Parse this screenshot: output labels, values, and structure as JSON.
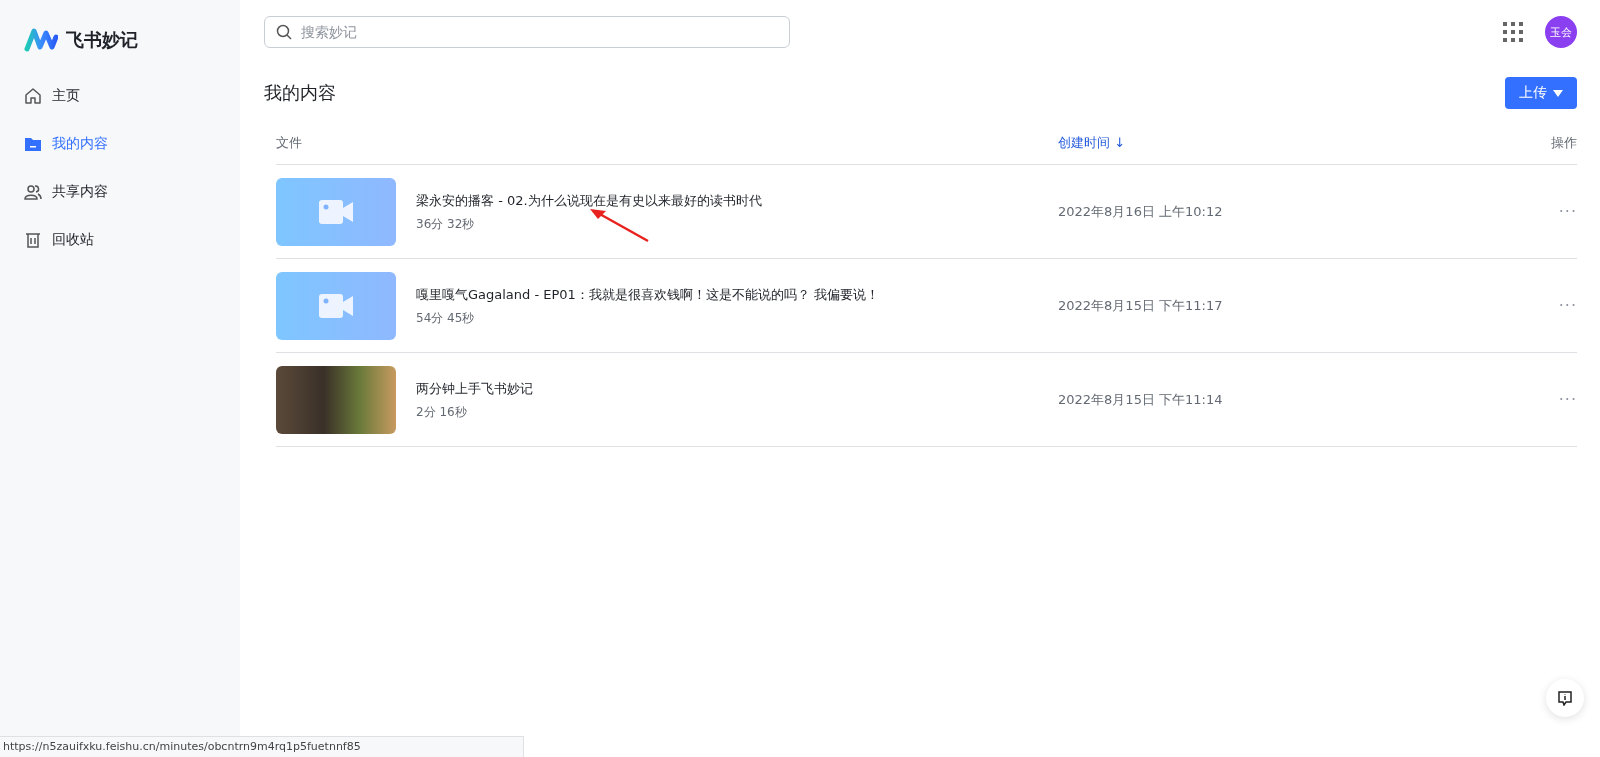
{
  "app": {
    "name": "飞书妙记"
  },
  "sidebar": {
    "items": [
      {
        "label": "主页",
        "kind": "home",
        "selected": false
      },
      {
        "label": "我的内容",
        "kind": "folder",
        "selected": true
      },
      {
        "label": "共享内容",
        "kind": "people",
        "selected": false
      },
      {
        "label": "回收站",
        "kind": "trash",
        "selected": false
      }
    ]
  },
  "search": {
    "placeholder": "搜索妙记"
  },
  "avatar": {
    "text": "玉会"
  },
  "page_title": "我的内容",
  "upload_button": {
    "label": "上传"
  },
  "table": {
    "columns": [
      {
        "label": "文件",
        "sorted": false
      },
      {
        "label": "创建时间 ↓",
        "sorted": true
      },
      {
        "label": "操作",
        "sorted": false
      }
    ],
    "rows": [
      {
        "kind": "video",
        "title": "梁永安的播客 - 02.为什么说现在是有史以来最好的读书时代",
        "duration": "36分 32秒",
        "created": "2022年8月16日 上午10:12",
        "more": "···",
        "annotated": true
      },
      {
        "kind": "video",
        "title": "嘎里嘎气Gagaland - EP01：我就是很喜欢钱啊！这是不能说的吗？ 我偏要说！",
        "duration": "54分 45秒",
        "created": "2022年8月15日 下午11:17",
        "more": "···",
        "annotated": false
      },
      {
        "kind": "photo",
        "title": "两分钟上手飞书妙记",
        "duration": "2分 16秒",
        "created": "2022年8月15日 下午11:14",
        "more": "···",
        "annotated": false
      }
    ]
  },
  "status_bar": {
    "url": "https://n5zauifxku.feishu.cn/minutes/obcntrn9m4rq1p5fuetnnf85"
  }
}
